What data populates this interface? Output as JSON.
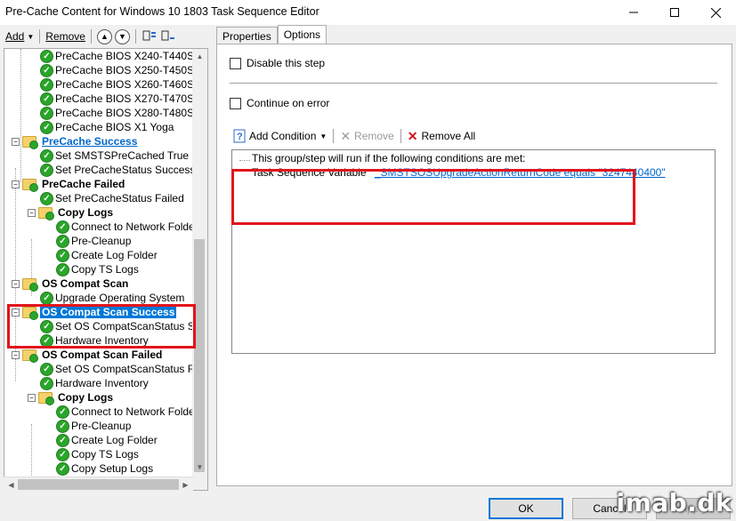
{
  "window": {
    "title": "Pre-Cache Content for Windows 10 1803 Task Sequence Editor"
  },
  "toolbar": {
    "add_label": "Add",
    "remove_label": "Remove"
  },
  "tree": {
    "items": [
      {
        "label": "PreCache BIOS X240-T440S"
      },
      {
        "label": "PreCache BIOS X250-T450S"
      },
      {
        "label": "PreCache BIOS X260-T460S"
      },
      {
        "label": "PreCache BIOS X270-T470S"
      },
      {
        "label": "PreCache BIOS X280-T480S"
      },
      {
        "label": "PreCache BIOS X1 Yoga"
      },
      {
        "label": "PreCache Success"
      },
      {
        "label": "Set SMSTSPreCached True"
      },
      {
        "label": "Set PreCacheStatus Success"
      },
      {
        "label": "PreCache Failed"
      },
      {
        "label": "Set PreCacheStatus Failed"
      },
      {
        "label": "Copy Logs"
      },
      {
        "label": "Connect to Network Folder"
      },
      {
        "label": "Pre-Cleanup"
      },
      {
        "label": "Create Log Folder"
      },
      {
        "label": "Copy TS Logs"
      },
      {
        "label": "OS Compat Scan"
      },
      {
        "label": "Upgrade Operating System"
      },
      {
        "label": "OS Compat Scan Success"
      },
      {
        "label": "Set OS CompatScanStatus Suc"
      },
      {
        "label": "Hardware Inventory"
      },
      {
        "label": "OS Compat Scan Failed"
      },
      {
        "label": "Set OS CompatScanStatus Faile"
      },
      {
        "label": "Hardware Inventory"
      },
      {
        "label": "Copy Logs"
      },
      {
        "label": "Connect to Network Folder"
      },
      {
        "label": "Pre-Cleanup"
      },
      {
        "label": "Create Log Folder"
      },
      {
        "label": "Copy TS Logs"
      },
      {
        "label": "Copy Setup Logs"
      }
    ]
  },
  "tabs": [
    {
      "label": "Properties"
    },
    {
      "label": "Options"
    }
  ],
  "options": {
    "disable_step": "Disable this step",
    "continue_on_error": "Continue on error",
    "add_condition": "Add Condition",
    "remove": "Remove",
    "remove_all": "Remove All",
    "cond_intro": "This group/step will run if the following conditions are met:",
    "cond_prefix": "Task Sequence Variable",
    "cond_value": "_SMSTSOSUpgradeActionReturnCode equals \"3247440400\""
  },
  "buttons": {
    "ok": "OK",
    "cancel": "Cancel",
    "apply": "Apply"
  },
  "watermark": "imab.dk",
  "colors": {
    "selection": "#0078d7",
    "highlight_red": "#e2141b",
    "link": "#0066cc",
    "success_green": "#2aa52a"
  }
}
